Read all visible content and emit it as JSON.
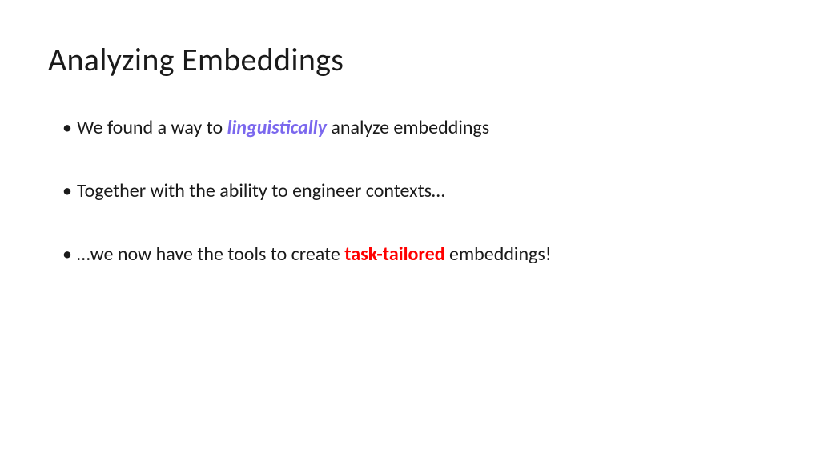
{
  "title": "Analyzing Embeddings",
  "bullets": [
    {
      "pre": "We found a way to ",
      "em": "linguistically",
      "emClass": "highlight-violet",
      "post": " analyze embeddings"
    },
    {
      "pre": "Together with the ability to engineer contexts…",
      "em": "",
      "emClass": "",
      "post": ""
    },
    {
      "pre": "…we now have the tools to create ",
      "em": "task-tailored",
      "emClass": "highlight-red",
      "post": " embeddings!"
    }
  ]
}
